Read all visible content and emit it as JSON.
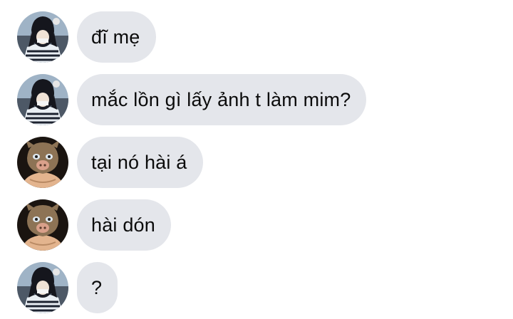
{
  "messages": [
    {
      "avatar": "obanai-avatar",
      "text": "đĩ mẹ"
    },
    {
      "avatar": "obanai-avatar",
      "text": "mắc lồn gì lấy ảnh t làm mim?"
    },
    {
      "avatar": "inosuke-avatar",
      "text": "tại nó hài á"
    },
    {
      "avatar": "inosuke-avatar",
      "text": "hài dón"
    },
    {
      "avatar": "obanai-avatar",
      "text": "?"
    }
  ],
  "colors": {
    "bubble": "#e4e6eb",
    "text": "#0b0b0b",
    "background": "#ffffff"
  }
}
